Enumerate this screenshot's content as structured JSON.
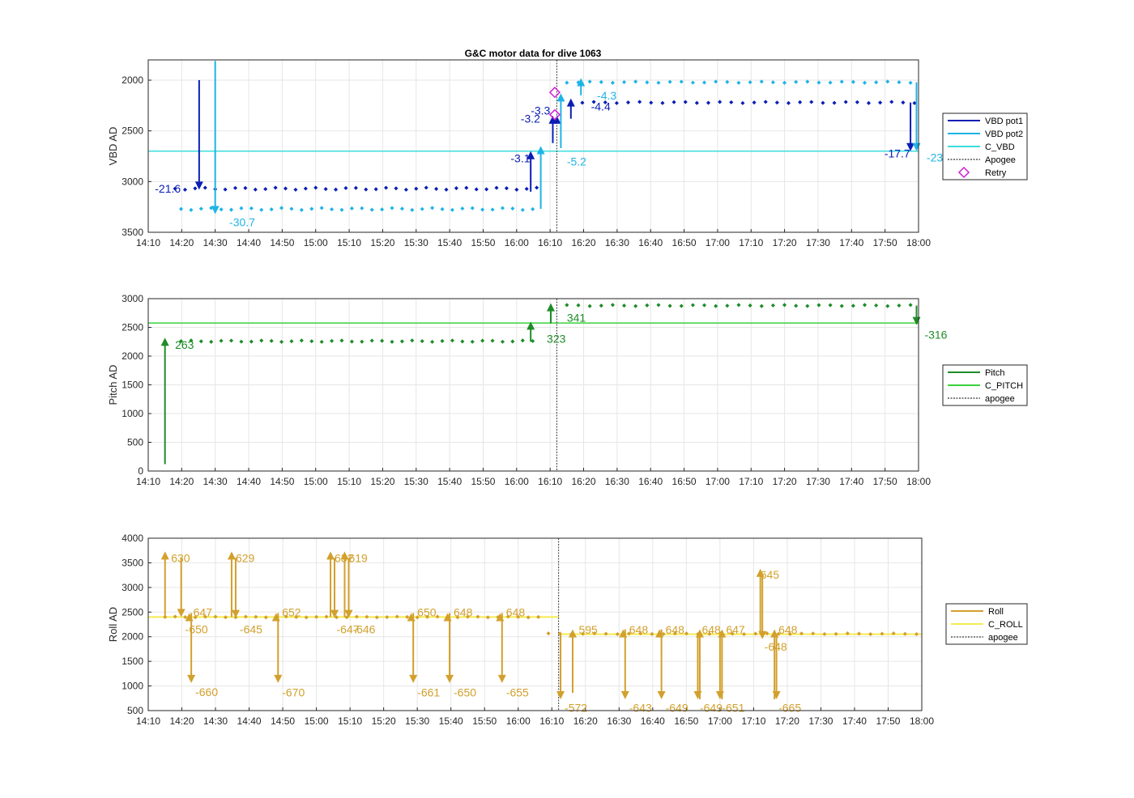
{
  "title": "G&C motor data for dive 1063",
  "time_ticks": [
    "14:10",
    "14:20",
    "14:30",
    "14:40",
    "14:50",
    "15:00",
    "15:10",
    "15:20",
    "15:30",
    "15:40",
    "15:50",
    "16:00",
    "16:10",
    "16:20",
    "16:30",
    "16:40",
    "16:50",
    "17:00",
    "17:10",
    "17:20",
    "17:30",
    "17:40",
    "17:50",
    "18:00"
  ],
  "colors": {
    "vbd_pot1": "#0a1eb4",
    "vbd_pot2": "#1eb4e6",
    "c_vbd": "#3cdcdc",
    "pitch": "#1e8c28",
    "c_pitch": "#3cd23c",
    "roll": "#d2a02d",
    "c_roll": "#f5eb50",
    "retry": "#d21ed2",
    "apogee": "#555555"
  },
  "chart_data": [
    {
      "type": "scatter",
      "ylabel": "VBD AD",
      "yreverse": true,
      "ylim": [
        1800,
        3500
      ],
      "yticks": [
        2000,
        2500,
        3000,
        3500
      ],
      "xlim_hours": [
        14.1667,
        18.0
      ],
      "apogee_hours": 16.2,
      "reference": {
        "name": "C_VBD",
        "value": 2700
      },
      "legend": {
        "placement": "outside-right",
        "entries": [
          {
            "label": "VBD pot1",
            "style": "line",
            "color": "#0a1eb4"
          },
          {
            "label": "VBD pot2",
            "style": "line",
            "color": "#1eb4e6"
          },
          {
            "label": "C_VBD",
            "style": "line",
            "color": "#3cdcdc"
          },
          {
            "label": "Apogee",
            "style": "dash",
            "color": "#555555"
          },
          {
            "label": "Retry",
            "style": "diamond",
            "color": "#d21ed2"
          }
        ]
      },
      "series": [
        {
          "name": "VBD pot1",
          "color": "#0a1eb4",
          "segments": [
            {
              "start": 14.3,
              "end": 16.1,
              "step": 0.05,
              "base": 3070,
              "amp": 10
            },
            {
              "start": 16.27,
              "end": 17.98,
              "step": 0.057,
              "base": 2220,
              "amp": 6
            }
          ]
        },
        {
          "name": "VBD pot2",
          "color": "#1eb4e6",
          "segments": [
            {
              "start": 14.33,
              "end": 16.1,
              "step": 0.05,
              "base": 3270,
              "amp": 10
            },
            {
              "start": 16.25,
              "end": 17.98,
              "step": 0.057,
              "base": 2020,
              "amp": 6
            }
          ]
        }
      ],
      "arrows": [
        {
          "x": 14.42,
          "from": 2000,
          "to": 3080,
          "color": "#0a1eb4",
          "label": "-21.6",
          "lx": 14.2,
          "ly": 3070
        },
        {
          "x": 14.5,
          "from": 1810,
          "to": 3320,
          "color": "#1eb4e6",
          "label": "-30.7",
          "lx": 14.57,
          "ly": 3400
        },
        {
          "x": 16.07,
          "from": 3100,
          "to": 2700,
          "color": "#0a1eb4",
          "label": "-3.1",
          "lx": 15.97,
          "ly": 2770
        },
        {
          "x": 16.12,
          "from": 3270,
          "to": 2650,
          "color": "#1eb4e6",
          "label": "-5.2",
          "lx": 16.25,
          "ly": 2800
        },
        {
          "x": 16.18,
          "from": 2620,
          "to": 2350,
          "color": "#0a1eb4",
          "label": "-3.3",
          "lx": 16.07,
          "ly": 2300
        },
        {
          "x": 16.2,
          "from": 2400,
          "to": 2350,
          "color": "#0a1eb4",
          "label": "-3.2",
          "lx": 16.02,
          "ly": 2380
        },
        {
          "x": 16.22,
          "from": 2670,
          "to": 2130,
          "color": "#1eb4e6",
          "label": "",
          "lx": 0,
          "ly": 0
        },
        {
          "x": 16.27,
          "from": 2380,
          "to": 2180,
          "color": "#0a1eb4",
          "label": "-4.4",
          "lx": 16.37,
          "ly": 2260
        },
        {
          "x": 16.32,
          "from": 2150,
          "to": 1980,
          "color": "#1eb4e6",
          "label": "-4.3",
          "lx": 16.4,
          "ly": 2150
        },
        {
          "x": 17.96,
          "from": 2220,
          "to": 2700,
          "color": "#0a1eb4",
          "label": "-17.7",
          "lx": 17.83,
          "ly": 2720
        },
        {
          "x": 17.99,
          "from": 2020,
          "to": 2700,
          "color": "#1eb4e6",
          "label": "-23",
          "lx": 18.04,
          "ly": 2760
        }
      ],
      "retry_points": [
        {
          "x": 16.19,
          "y": 2120
        },
        {
          "x": 16.19,
          "y": 2340
        }
      ]
    },
    {
      "type": "scatter",
      "ylabel": "Pitch AD",
      "yreverse": false,
      "ylim": [
        0,
        3000
      ],
      "yticks": [
        0,
        500,
        1000,
        1500,
        2000,
        2500,
        3000
      ],
      "xlim_hours": [
        14.1667,
        18.0
      ],
      "apogee_hours": 16.2,
      "reference": {
        "name": "C_PITCH",
        "value": 2575
      },
      "legend": {
        "placement": "outside-right",
        "entries": [
          {
            "label": "Pitch",
            "style": "line",
            "color": "#1e8c28"
          },
          {
            "label": "C_PITCH",
            "style": "line",
            "color": "#3cd23c"
          },
          {
            "label": "apogee",
            "style": "dash",
            "color": "#555555"
          }
        ]
      },
      "series": [
        {
          "name": "Pitch",
          "color": "#1e8c28",
          "segments": [
            {
              "start": 14.33,
              "end": 16.1,
              "step": 0.05,
              "base": 2260,
              "amp": 12
            },
            {
              "start": 16.25,
              "end": 17.98,
              "step": 0.057,
              "base": 2880,
              "amp": 10
            }
          ]
        }
      ],
      "arrows": [
        {
          "x": 14.25,
          "from": 120,
          "to": 2320,
          "color": "#1e8c28",
          "label": "263",
          "lx": 14.3,
          "ly": 2200
        },
        {
          "x": 16.07,
          "from": 2250,
          "to": 2600,
          "color": "#1e8c28",
          "label": "323",
          "lx": 16.15,
          "ly": 2300
        },
        {
          "x": 16.17,
          "from": 2570,
          "to": 2920,
          "color": "#1e8c28",
          "label": "341",
          "lx": 16.25,
          "ly": 2670
        },
        {
          "x": 17.99,
          "from": 2880,
          "to": 2540,
          "color": "#1e8c28",
          "label": "-316",
          "lx": 18.03,
          "ly": 2370
        }
      ],
      "retry_points": []
    },
    {
      "type": "scatter",
      "ylabel": "Roll AD",
      "yreverse": false,
      "ylim": [
        500,
        4000
      ],
      "yticks": [
        500,
        1000,
        1500,
        2000,
        2500,
        3000,
        3500,
        4000
      ],
      "xlim_hours": [
        14.1667,
        18.0
      ],
      "apogee_hours": 16.2,
      "reference": {
        "name": "C_ROLL",
        "value": 2400,
        "value_after_apogee": 2050
      },
      "legend": {
        "placement": "outside-right",
        "entries": [
          {
            "label": "Roll",
            "style": "line",
            "color": "#d2a02d"
          },
          {
            "label": "C_ROLL",
            "style": "line",
            "color": "#f5eb50"
          },
          {
            "label": "apogee",
            "style": "dash",
            "color": "#555555"
          }
        ]
      },
      "series": [
        {
          "name": "Roll",
          "color": "#d2a02d",
          "segments": [
            {
              "start": 14.25,
              "end": 16.1,
              "step": 0.05,
              "base": 2400,
              "amp": 8
            },
            {
              "start": 16.15,
              "end": 17.98,
              "step": 0.057,
              "base": 2060,
              "amp": 8
            }
          ]
        }
      ],
      "arrows": [
        {
          "x": 14.25,
          "from": 2400,
          "to": 3730,
          "color": "#d2a02d",
          "label": "630",
          "lx": 14.28,
          "ly": 3600
        },
        {
          "x": 14.33,
          "from": 3600,
          "to": 2400,
          "color": "#d2a02d",
          "label": "-650",
          "lx": 14.35,
          "ly": 2150
        },
        {
          "x": 14.37,
          "from": 2400,
          "to": 2480,
          "color": "#d2a02d",
          "label": "647",
          "lx": 14.39,
          "ly": 2500
        },
        {
          "x": 14.38,
          "from": 2480,
          "to": 1060,
          "color": "#d2a02d",
          "label": "-660",
          "lx": 14.4,
          "ly": 880
        },
        {
          "x": 14.58,
          "from": 2400,
          "to": 3730,
          "color": "#d2a02d",
          "label": "629",
          "lx": 14.6,
          "ly": 3600
        },
        {
          "x": 14.6,
          "from": 3600,
          "to": 2380,
          "color": "#d2a02d",
          "label": "-645",
          "lx": 14.62,
          "ly": 2150
        },
        {
          "x": 14.8,
          "from": 2400,
          "to": 2480,
          "color": "#d2a02d",
          "label": "652",
          "lx": 14.83,
          "ly": 2500
        },
        {
          "x": 14.81,
          "from": 2480,
          "to": 1060,
          "color": "#d2a02d",
          "label": "-670",
          "lx": 14.83,
          "ly": 870
        },
        {
          "x": 15.07,
          "from": 2400,
          "to": 3730,
          "color": "#d2a02d",
          "label": "632",
          "lx": 15.09,
          "ly": 3600
        },
        {
          "x": 15.09,
          "from": 3600,
          "to": 2380,
          "color": "#d2a02d",
          "label": "-647",
          "lx": 15.1,
          "ly": 2150
        },
        {
          "x": 15.14,
          "from": 2400,
          "to": 3730,
          "color": "#d2a02d",
          "label": "619",
          "lx": 15.16,
          "ly": 3600
        },
        {
          "x": 15.16,
          "from": 3600,
          "to": 2380,
          "color": "#d2a02d",
          "label": "-646",
          "lx": 15.18,
          "ly": 2150
        },
        {
          "x": 15.47,
          "from": 2400,
          "to": 2480,
          "color": "#d2a02d",
          "label": "650",
          "lx": 15.5,
          "ly": 2500
        },
        {
          "x": 15.48,
          "from": 2480,
          "to": 1060,
          "color": "#d2a02d",
          "label": "-661",
          "lx": 15.5,
          "ly": 870
        },
        {
          "x": 15.65,
          "from": 2400,
          "to": 2480,
          "color": "#d2a02d",
          "label": "648",
          "lx": 15.68,
          "ly": 2500
        },
        {
          "x": 15.66,
          "from": 2480,
          "to": 1060,
          "color": "#d2a02d",
          "label": "-650",
          "lx": 15.68,
          "ly": 870
        },
        {
          "x": 15.91,
          "from": 2400,
          "to": 2480,
          "color": "#d2a02d",
          "label": "648",
          "lx": 15.94,
          "ly": 2500
        },
        {
          "x": 15.92,
          "from": 2480,
          "to": 1060,
          "color": "#d2a02d",
          "label": "-655",
          "lx": 15.94,
          "ly": 870
        },
        {
          "x": 16.21,
          "from": 2060,
          "to": 730,
          "color": "#d2a02d",
          "label": "-572",
          "lx": 16.23,
          "ly": 560
        },
        {
          "x": 16.27,
          "from": 860,
          "to": 2150,
          "color": "#d2a02d",
          "label": "595",
          "lx": 16.3,
          "ly": 2140
        },
        {
          "x": 16.52,
          "from": 2060,
          "to": 2150,
          "color": "#d2a02d",
          "label": "648",
          "lx": 16.55,
          "ly": 2140
        },
        {
          "x": 16.53,
          "from": 2150,
          "to": 730,
          "color": "#d2a02d",
          "label": "-643",
          "lx": 16.55,
          "ly": 560
        },
        {
          "x": 16.7,
          "from": 2060,
          "to": 2150,
          "color": "#d2a02d",
          "label": "648",
          "lx": 16.73,
          "ly": 2140
        },
        {
          "x": 16.71,
          "from": 2150,
          "to": 730,
          "color": "#d2a02d",
          "label": "-649",
          "lx": 16.73,
          "ly": 560
        },
        {
          "x": 16.89,
          "from": 2060,
          "to": 730,
          "color": "#d2a02d",
          "label": "-649",
          "lx": 16.9,
          "ly": 560
        },
        {
          "x": 16.9,
          "from": 730,
          "to": 2150,
          "color": "#d2a02d",
          "label": "648",
          "lx": 16.91,
          "ly": 2140
        },
        {
          "x": 17.0,
          "from": 2060,
          "to": 730,
          "color": "#d2a02d",
          "label": "-651",
          "lx": 17.01,
          "ly": 560
        },
        {
          "x": 17.01,
          "from": 730,
          "to": 2150,
          "color": "#d2a02d",
          "label": "647",
          "lx": 17.03,
          "ly": 2140
        },
        {
          "x": 17.2,
          "from": 2060,
          "to": 3380,
          "color": "#d2a02d",
          "label": "645",
          "lx": 17.2,
          "ly": 3260
        },
        {
          "x": 17.21,
          "from": 3280,
          "to": 1950,
          "color": "#d2a02d",
          "label": "-648",
          "lx": 17.22,
          "ly": 1800
        },
        {
          "x": 17.27,
          "from": 730,
          "to": 2150,
          "color": "#d2a02d",
          "label": "648",
          "lx": 17.29,
          "ly": 2140
        },
        {
          "x": 17.28,
          "from": 2060,
          "to": 730,
          "color": "#d2a02d",
          "label": "-665",
          "lx": 17.29,
          "ly": 560
        }
      ],
      "retry_points": []
    }
  ]
}
